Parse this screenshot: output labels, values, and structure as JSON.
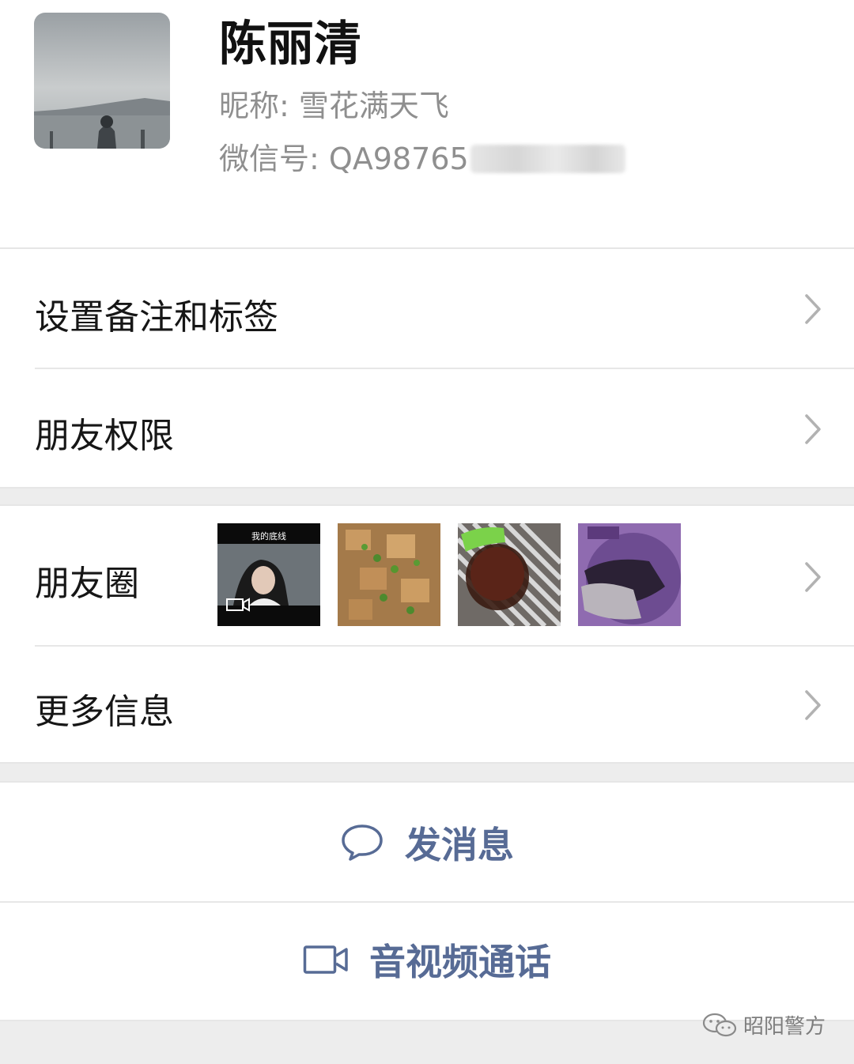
{
  "profile": {
    "name": "陈丽清",
    "nickname_label": "昵称:",
    "nickname": "雪花满天飞",
    "wechat_id_label": "微信号:",
    "wechat_id_visible": "QA98765"
  },
  "menu": {
    "remark_tags": "设置备注和标签",
    "friend_permissions": "朋友权限",
    "moments": "朋友圈",
    "moments_video_caption": "我的底线",
    "more_info": "更多信息"
  },
  "actions": {
    "send_message": "发消息",
    "av_call": "音视频通话"
  },
  "watermark": {
    "text": "昭阳警方"
  },
  "colors": {
    "link_blue": "#576b95",
    "background": "#ededed",
    "card": "#ffffff"
  }
}
